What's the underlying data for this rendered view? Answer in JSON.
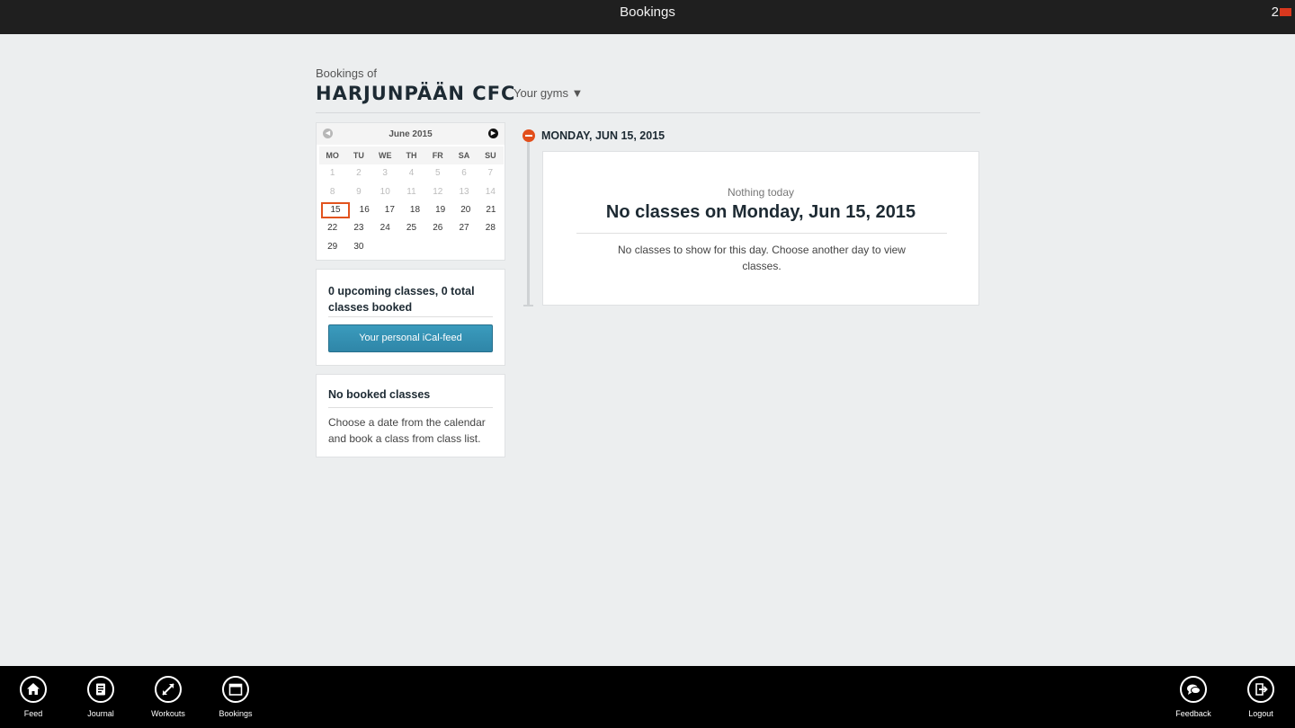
{
  "topbar": {
    "title": "Bookings",
    "count": "2"
  },
  "header": {
    "subtitle": "Bookings of",
    "title": "HARJUNPÄÄN CFC",
    "gym_select": "Your gyms ▼"
  },
  "calendar": {
    "month": "June 2015",
    "weekdays": [
      "MO",
      "TU",
      "WE",
      "TH",
      "FR",
      "SA",
      "SU"
    ],
    "weeks": [
      [
        "1",
        "2",
        "3",
        "4",
        "5",
        "6",
        "7"
      ],
      [
        "8",
        "9",
        "10",
        "11",
        "12",
        "13",
        "14"
      ],
      [
        "15",
        "16",
        "17",
        "18",
        "19",
        "20",
        "21"
      ],
      [
        "22",
        "23",
        "24",
        "25",
        "26",
        "27",
        "28"
      ],
      [
        "29",
        "30",
        "",
        "",
        "",
        "",
        ""
      ]
    ],
    "selected": "15"
  },
  "summary": {
    "text": "0 upcoming classes, 0 total classes booked",
    "ical_label": "Your personal iCal-feed"
  },
  "no_booked": {
    "title": "No booked classes",
    "text": "Choose a date from the calendar and book a class from class list."
  },
  "day": {
    "label": "MONDAY, JUN 15, 2015",
    "sub": "Nothing today",
    "title": "No classes on Monday, Jun 15, 2015",
    "text": "No classes to show for this day. Choose another day to view classes."
  },
  "appbar": {
    "feed": "Feed",
    "journal": "Journal",
    "workouts": "Workouts",
    "bookings": "Bookings",
    "feedback": "Feedback",
    "logout": "Logout"
  },
  "colors": {
    "accent": "#e24e1b",
    "button": "#3490b3",
    "bar": "#000000"
  }
}
